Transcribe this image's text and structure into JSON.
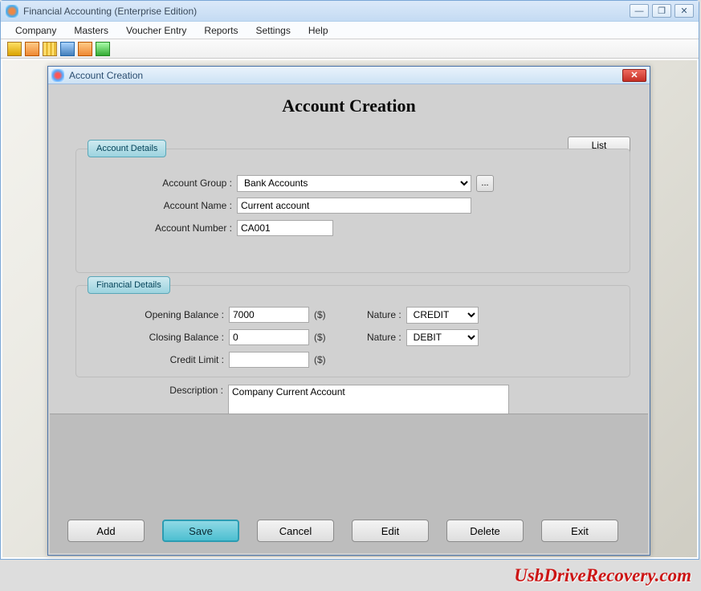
{
  "window": {
    "title": "Financial Accounting (Enterprise Edition)"
  },
  "menubar": [
    "Company",
    "Masters",
    "Voucher Entry",
    "Reports",
    "Settings",
    "Help"
  ],
  "dialog": {
    "title": "Account Creation",
    "heading": "Account Creation",
    "list_button": "List",
    "close_glyph": "✕",
    "account_details": {
      "legend": "Account Details",
      "group_label": "Account Group  :",
      "group_value": "Bank Accounts",
      "browse_label": "...",
      "name_label": "Account Name  :",
      "name_value": "Current account",
      "number_label": "Account Number  :",
      "number_value": "CA001"
    },
    "financial_details": {
      "legend": "Financial Details",
      "opening_label": "Opening Balance  :",
      "opening_value": "7000",
      "closing_label": "Closing Balance  :",
      "closing_value": "0",
      "credit_limit_label": "Credit Limit  :",
      "credit_limit_value": "",
      "currency": "($)",
      "nature_label": "Nature  :",
      "nature1_value": "CREDIT",
      "nature2_value": "DEBIT"
    },
    "description_label": "Description  :",
    "description_value": "Company Current Account",
    "buttons": {
      "add": "Add",
      "save": "Save",
      "cancel": "Cancel",
      "edit": "Edit",
      "delete": "Delete",
      "exit": "Exit"
    }
  },
  "watermark": "UsbDriveRecovery.com"
}
